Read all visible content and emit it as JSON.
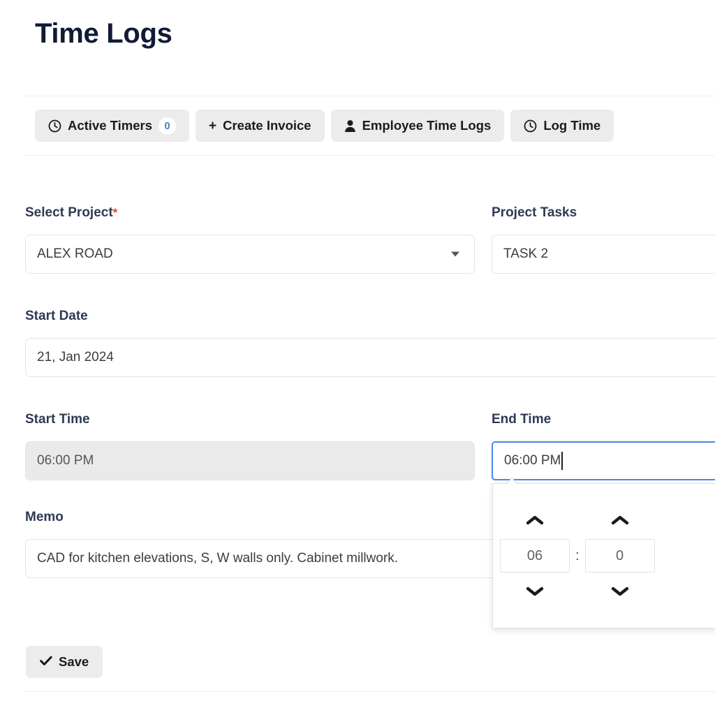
{
  "page": {
    "title": "Time Logs"
  },
  "action_bar": {
    "buttons": [
      {
        "label": "Active Timers",
        "icon": "clock-icon",
        "badge": "0"
      },
      {
        "label": "Create Invoice",
        "icon": "plus-icon"
      },
      {
        "label": "Employee Time Logs",
        "icon": "user-icon"
      },
      {
        "label": "Log Time",
        "icon": "clock-icon"
      }
    ]
  },
  "form": {
    "select_project": {
      "label": "Select Project",
      "required_marker": "*",
      "value": "ALEX ROAD"
    },
    "project_tasks": {
      "label": "Project Tasks",
      "value": "TASK 2"
    },
    "start_date": {
      "label": "Start Date",
      "value": "21, Jan 2024"
    },
    "start_time": {
      "label": "Start Time",
      "value": "06:00 PM"
    },
    "end_time": {
      "label": "End Time",
      "value": "06:00 PM"
    },
    "memo": {
      "label": "Memo",
      "value": "CAD for kitchen elevations, S, W walls only. Cabinet millwork."
    }
  },
  "time_picker": {
    "hour": "06",
    "separator": ":",
    "minute": "0"
  },
  "footer": {
    "save_label": "Save",
    "save_icon": "check-icon"
  },
  "colors": {
    "title": "#111b35",
    "label": "#2d3a53",
    "required": "#e8443a",
    "badge_text": "#4a80c4",
    "focus_border": "#4a87e8",
    "button_bg": "#ececec",
    "disabled_bg": "#eaeaea"
  }
}
